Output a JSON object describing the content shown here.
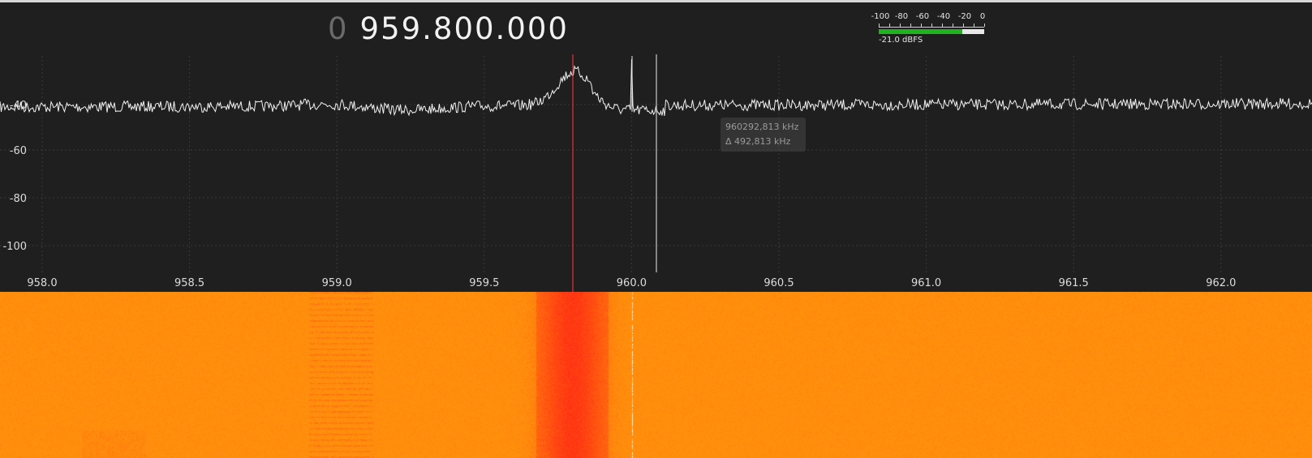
{
  "frequency": {
    "prefix": "0",
    "value": "959.800.000"
  },
  "level_meter": {
    "tick_labels": [
      "-100",
      "-80",
      "-60",
      "-40",
      "-20",
      "0"
    ],
    "readout": "-21.0 dBFS",
    "level_dbfs": -21.0,
    "fill_color": "#1db41d"
  },
  "spectrum": {
    "y_labels": [
      "-40",
      "-60",
      "-80",
      "-100"
    ],
    "x_labels": [
      "958.0",
      "958.5",
      "959.0",
      "959.5",
      "960.0",
      "960.5",
      "961.0",
      "961.5",
      "962.0"
    ],
    "trace_color": "#f2f2f2",
    "tuned_marker_color": "#ff3c3c",
    "cursor_color": "#c8c8c8"
  },
  "cursor_tooltip": {
    "line1": "960292,813 kHz",
    "line2": "Δ 492,813 kHz"
  },
  "colors": {
    "background": "#1f1f1f",
    "waterfall_base": "#ff8c0a",
    "waterfall_hot": "#ff2a12"
  }
}
